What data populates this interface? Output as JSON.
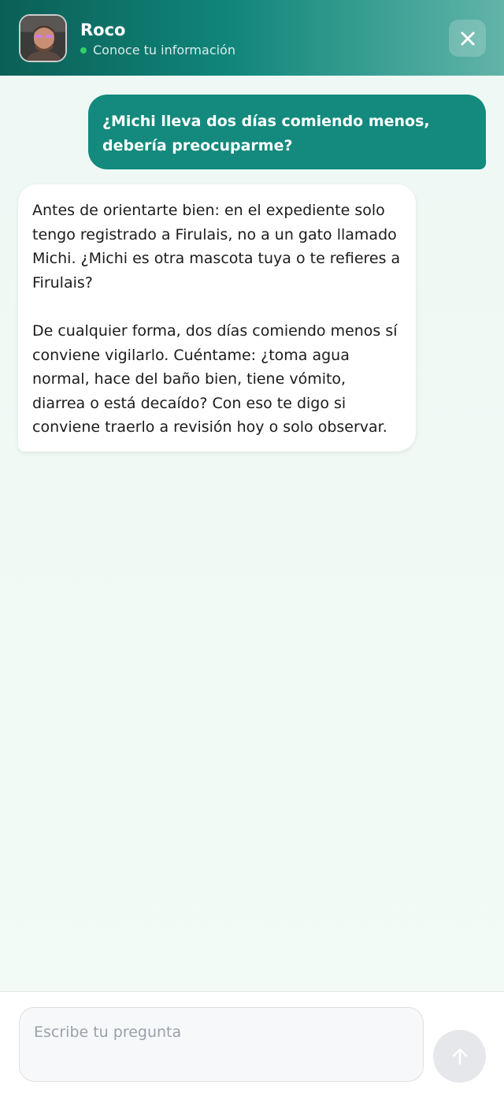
{
  "header": {
    "name": "Roco",
    "status": "Conoce tu información",
    "status_color": "#34d06a",
    "avatar_icon": "user-photo-icon",
    "close_icon": "close-icon"
  },
  "messages": [
    {
      "role": "user",
      "text": "¿Michi lleva dos días comiendo menos, debería preocuparme?"
    },
    {
      "role": "assistant",
      "paragraphs": [
        "Antes de orientarte bien: en el expediente solo tengo registrado a Firulais, no a un gato llamado Michi. ¿Michi es otra mascota tuya o te refieres a Firulais?",
        "De cualquier forma, dos días comiendo menos sí conviene vigilarlo. Cuéntame: ¿toma agua normal, hace del baño bien, tiene vómito, diarrea o está decaído? Con eso te digo si conviene traerlo a revisión hoy o solo observar."
      ]
    }
  ],
  "composer": {
    "placeholder": "Escribe tu pregunta",
    "value": "",
    "send_icon": "arrow-up-icon"
  },
  "colors": {
    "accent": "#138a7d",
    "header_dark": "#0b5f56"
  }
}
